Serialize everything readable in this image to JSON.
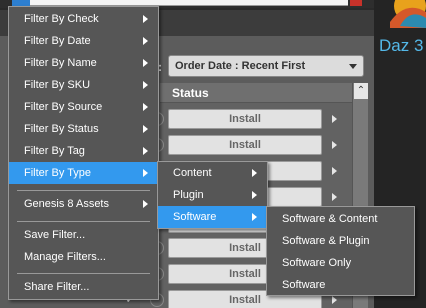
{
  "menu_main": {
    "items": [
      {
        "label": "Filter By Check",
        "has_submenu": true
      },
      {
        "label": "Filter By Date",
        "has_submenu": true
      },
      {
        "label": "Filter By Name",
        "has_submenu": true
      },
      {
        "label": "Filter By SKU",
        "has_submenu": true
      },
      {
        "label": "Filter By Source",
        "has_submenu": true
      },
      {
        "label": "Filter By Status",
        "has_submenu": true
      },
      {
        "label": "Filter By Tag",
        "has_submenu": true
      },
      {
        "label": "Filter By Type",
        "has_submenu": true,
        "highlighted": true
      },
      {
        "label": "Genesis 8 Assets",
        "has_submenu": true
      },
      {
        "label": "Save Filter...",
        "has_submenu": false
      },
      {
        "label": "Manage Filters...",
        "has_submenu": false
      },
      {
        "label": "Share Filter...",
        "has_submenu": false
      }
    ]
  },
  "menu_type": {
    "items": [
      {
        "label": "Content",
        "has_submenu": true
      },
      {
        "label": "Plugin",
        "has_submenu": true
      },
      {
        "label": "Software",
        "has_submenu": true,
        "highlighted": true
      }
    ]
  },
  "menu_software": {
    "items": [
      {
        "label": "Software & Content"
      },
      {
        "label": "Software & Plugin"
      },
      {
        "label": "Software Only"
      },
      {
        "label": "Software"
      }
    ]
  },
  "sort": {
    "colon": ":",
    "value": "Order Date : Recent First"
  },
  "table": {
    "header": "Status",
    "install_label": "Install"
  },
  "brand": {
    "text": "Daz 3",
    "accent": "#54b8e8"
  },
  "colors": {
    "highlight": "#3399ee",
    "menu_bg": "#565656"
  }
}
